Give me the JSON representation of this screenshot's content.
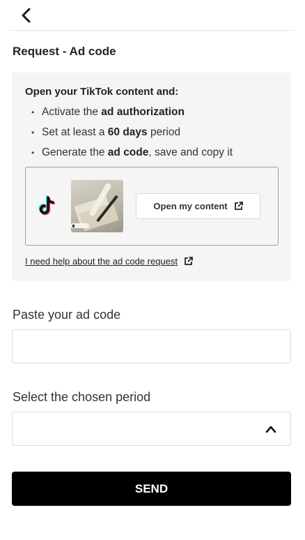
{
  "header": {
    "back_icon": "chevron-left-icon"
  },
  "page_title": "Request - Ad code",
  "instructions": {
    "heading": "Open your TikTok content and:",
    "steps": [
      {
        "before": "Activate the ",
        "bold": "ad authorization",
        "after": ""
      },
      {
        "before": "Set at least a ",
        "bold": "60 days",
        "after": " period"
      },
      {
        "before": "Generate the ",
        "bold": "ad code",
        "after": ", save and copy it"
      }
    ],
    "bullet": "•"
  },
  "content_preview": {
    "platform_icon": "tiktok-logo-icon",
    "open_button_label": "Open my content",
    "open_button_icon": "external-link-icon"
  },
  "help_link": {
    "label": "I need help about the ad code request",
    "icon": "external-link-icon"
  },
  "ad_code_field": {
    "label": "Paste your ad code",
    "value": "",
    "placeholder": ""
  },
  "period_field": {
    "label": "Select the chosen period",
    "selected_value": "",
    "icon": "chevron-up-icon"
  },
  "send_button": {
    "label": "SEND"
  },
  "colors": {
    "primary_button": "#000000",
    "card_background": "#f5f5f5",
    "tiktok_cyan": "#25F4EE",
    "tiktok_red": "#FE2C55"
  }
}
